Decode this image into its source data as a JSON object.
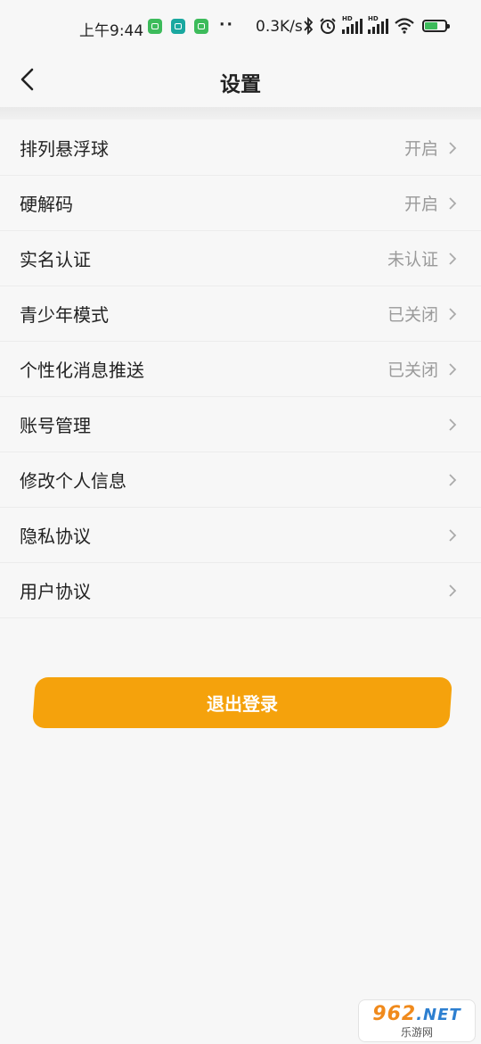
{
  "status_bar": {
    "time": "上午9:44",
    "dots": "··",
    "net_speed": "0.3K/s",
    "hd1": "HD",
    "hd2": "HD"
  },
  "nav": {
    "title": "设置"
  },
  "settings": [
    {
      "label": "排列悬浮球",
      "value": "开启"
    },
    {
      "label": "硬解码",
      "value": "开启"
    },
    {
      "label": "实名认证",
      "value": "未认证"
    },
    {
      "label": "青少年模式",
      "value": "已关闭"
    },
    {
      "label": "个性化消息推送",
      "value": "已关闭"
    },
    {
      "label": "账号管理",
      "value": ""
    },
    {
      "label": "修改个人信息",
      "value": ""
    },
    {
      "label": "隐私协议",
      "value": ""
    },
    {
      "label": "用户协议",
      "value": ""
    }
  ],
  "logout_label": "退出登录",
  "watermark": {
    "logo_num": "962",
    "logo_net": ".NET",
    "sub": "乐游网"
  },
  "colors": {
    "accent": "#f5a20c",
    "background": "#f7f7f7",
    "value_text": "#9a9a9a"
  }
}
